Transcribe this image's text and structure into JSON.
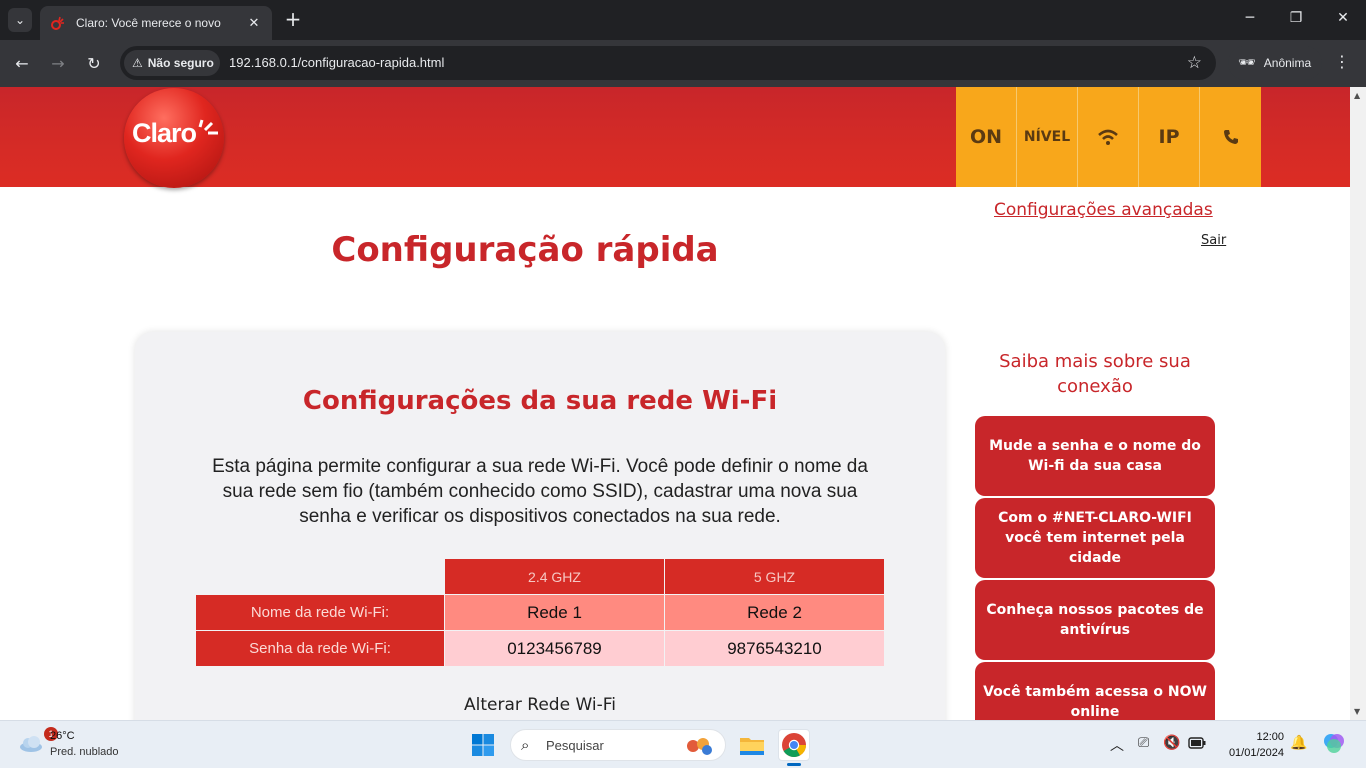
{
  "browser": {
    "tab_title": "Claro: Você merece o novo",
    "security_label": "Não seguro",
    "url": "192.168.0.1/configuracao-rapida.html",
    "profile_label": "Anônima"
  },
  "header": {
    "logo_text": "Claro",
    "status_icons": [
      {
        "label": "ON"
      },
      {
        "label": "NÍVEL"
      },
      {
        "icon": "wifi-icon"
      },
      {
        "label": "IP"
      },
      {
        "icon": "phone-icon"
      }
    ]
  },
  "page": {
    "advanced_link": "Configurações avançadas",
    "logout_link": "Sair",
    "title": "Configuração rápida"
  },
  "card": {
    "title": "Configurações da sua rede Wi-Fi",
    "description": "Esta página permite configurar a sua rede Wi-Fi. Você pode definir o nome da sua rede sem fio (também conhecido como SSID), cadastrar uma nova sua senha e verificar os dispositivos conectados na sua rede.",
    "table": {
      "bands": [
        "2.4 GHZ",
        "5 GHZ"
      ],
      "rows": [
        {
          "label": "Nome da rede Wi-Fi:",
          "values": [
            "Rede 1",
            "Rede 2"
          ]
        },
        {
          "label": "Senha da rede Wi-Fi:",
          "values": [
            "0123456789",
            "9876543210"
          ]
        }
      ]
    },
    "change_link": "Alterar Rede Wi-Fi"
  },
  "sidebar": {
    "title": "Saiba mais sobre sua conexão",
    "buttons": [
      "Mude a senha e o nome do Wi-fi da sua casa",
      "Com o #NET-CLARO-WIFI você tem internet pela cidade",
      "Conheça nossos pacotes de antivírus",
      "Você também acessa o NOW online"
    ]
  },
  "taskbar": {
    "weather_badge": "1",
    "temperature": "26°C",
    "weather_condition": "Pred. nublado",
    "search_placeholder": "Pesquisar",
    "time": "12:00",
    "date": "01/01/2024"
  },
  "colors": {
    "brand_red": "#c8262a",
    "status_orange": "#f8a71b",
    "row_name_bg": "#ff8a80",
    "row_pass_bg": "#ffcdd2"
  }
}
